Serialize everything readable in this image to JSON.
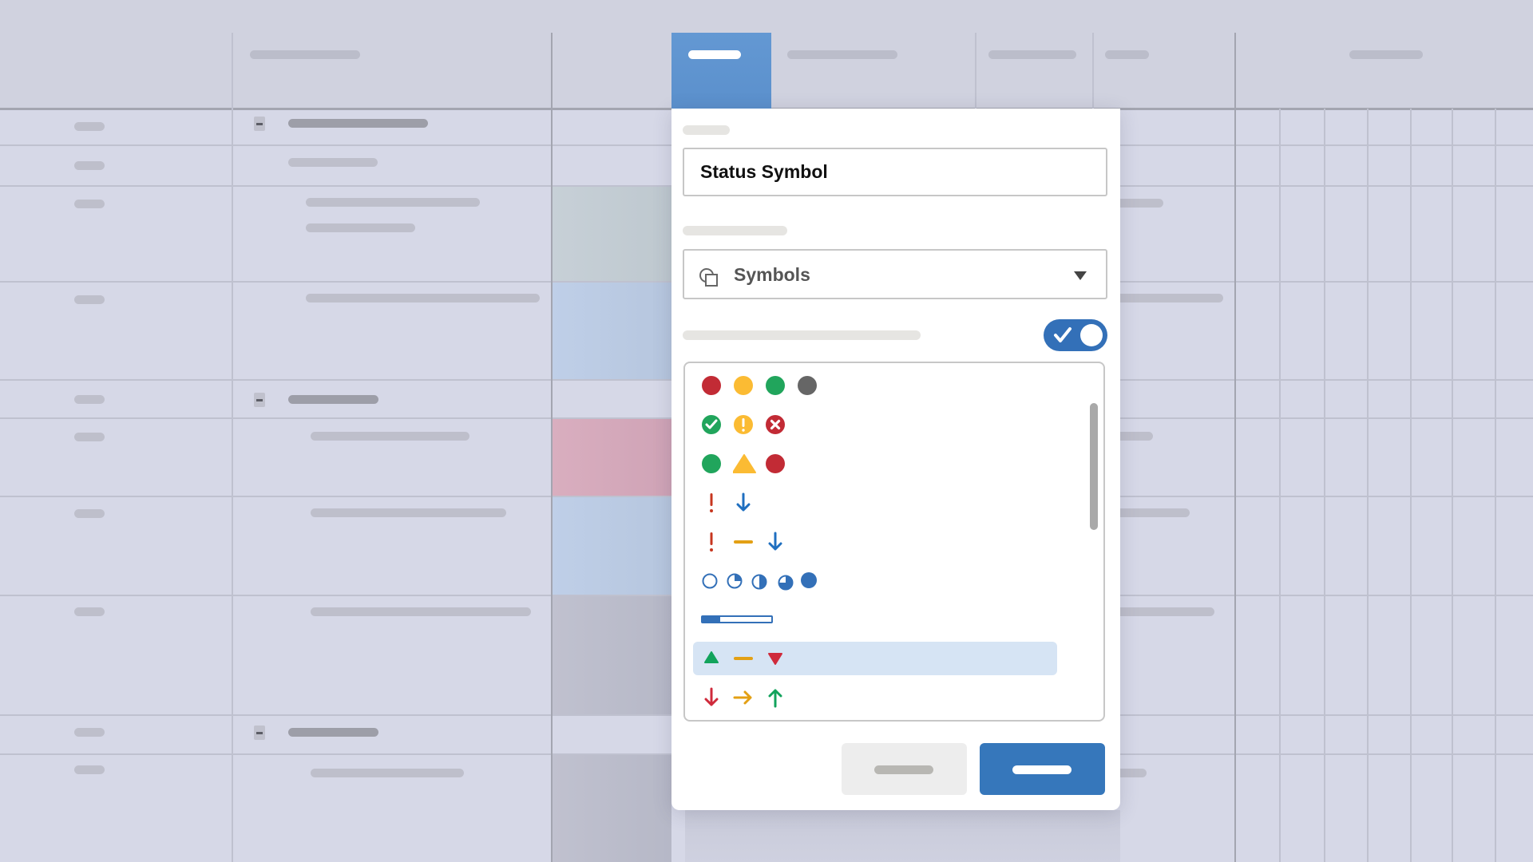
{
  "popup": {
    "name_field": {
      "value": "Status Symbol"
    },
    "type_select": {
      "selected": "Symbols",
      "icon": "symbols-icon"
    },
    "toggle": {
      "checked": true,
      "icon": "check-icon"
    },
    "symbol_sets": [
      {
        "id": "colored-dots",
        "symbols": [
          {
            "icon": "filled-circle",
            "color": "#c22b35"
          },
          {
            "icon": "filled-circle",
            "color": "#fbbb33"
          },
          {
            "icon": "filled-circle",
            "color": "#21a55c"
          },
          {
            "icon": "filled-circle",
            "color": "#666666"
          }
        ]
      },
      {
        "id": "status-badges",
        "symbols": [
          {
            "icon": "check-circle",
            "color": "#21a55c"
          },
          {
            "icon": "exclamation-circle",
            "color": "#fbbb33"
          },
          {
            "icon": "x-circle",
            "color": "#c22b35"
          }
        ]
      },
      {
        "id": "shapes",
        "symbols": [
          {
            "icon": "filled-circle",
            "color": "#21a55c"
          },
          {
            "icon": "triangle",
            "color": "#fbbb33"
          },
          {
            "icon": "filled-circle",
            "color": "#c22b35"
          }
        ]
      },
      {
        "id": "priority-two",
        "symbols": [
          {
            "icon": "exclamation",
            "color": "#c7361f"
          },
          {
            "icon": "arrow-down",
            "color": "#1f6fc0"
          }
        ]
      },
      {
        "id": "priority-three",
        "symbols": [
          {
            "icon": "exclamation",
            "color": "#c7361f"
          },
          {
            "icon": "dash",
            "color": "#e3a014"
          },
          {
            "icon": "arrow-down",
            "color": "#1f6fc0"
          }
        ]
      },
      {
        "id": "harvey-balls",
        "symbols": [
          {
            "icon": "harvey-0",
            "color": "#3370b8"
          },
          {
            "icon": "harvey-25",
            "color": "#3370b8"
          },
          {
            "icon": "harvey-50",
            "color": "#3370b8"
          },
          {
            "icon": "harvey-75",
            "color": "#3370b8"
          },
          {
            "icon": "harvey-100",
            "color": "#3370b8"
          }
        ]
      },
      {
        "id": "progress-bar",
        "symbols": [
          {
            "icon": "progress-bar",
            "color": "#3370b8",
            "progress": 0.25
          }
        ]
      },
      {
        "id": "trend-triangles",
        "selected": true,
        "symbols": [
          {
            "icon": "triangle-up",
            "color": "#12a35c"
          },
          {
            "icon": "dash",
            "color": "#e3a014"
          },
          {
            "icon": "triangle-down",
            "color": "#cf2a3b"
          }
        ]
      },
      {
        "id": "trend-arrows",
        "symbols": [
          {
            "icon": "arrow-down",
            "color": "#cf2a3b"
          },
          {
            "icon": "arrow-right",
            "color": "#e3a014"
          },
          {
            "icon": "arrow-up",
            "color": "#12a35c"
          }
        ]
      }
    ]
  },
  "colors": {
    "accent": "#3677bb",
    "selected_column_header": "#5f95d0",
    "row_highlight_green": "#c5ced6",
    "row_highlight_blue": "#bfcfe8",
    "row_highlight_pink": "#d8aebf",
    "row_highlight_gray": "#bfc0cf"
  }
}
